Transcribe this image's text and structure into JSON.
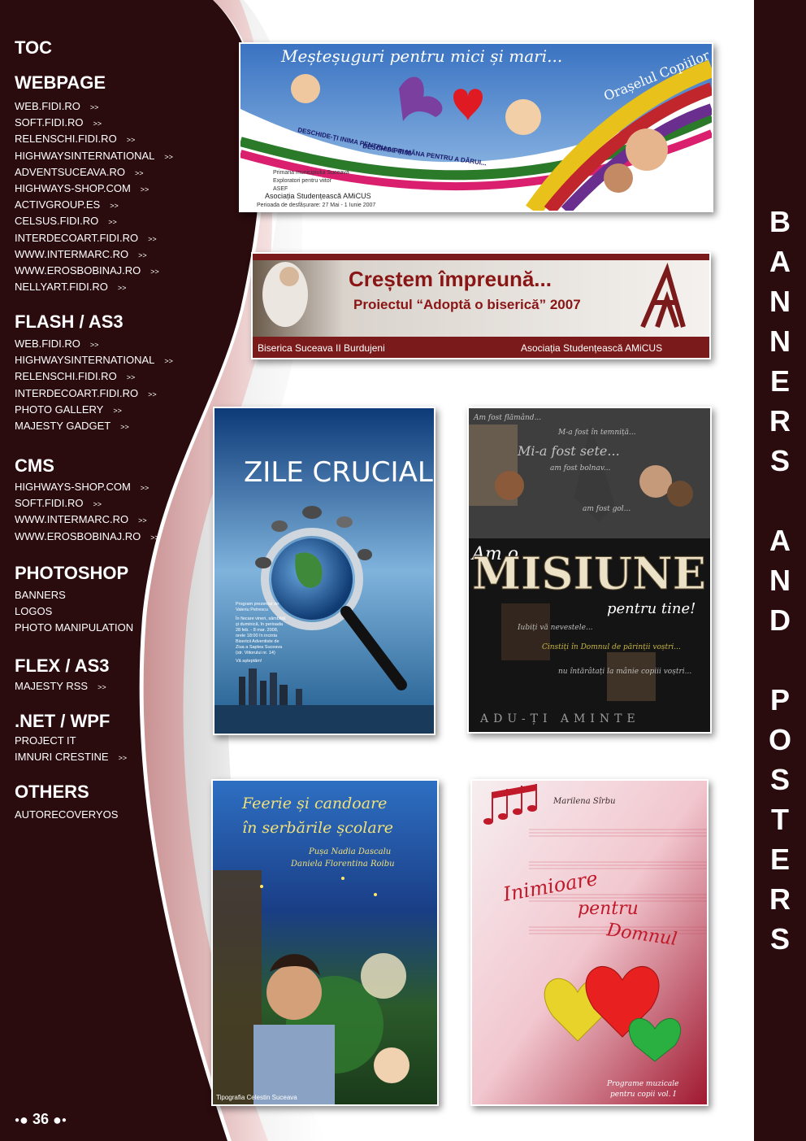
{
  "toc": {
    "title": "TOC",
    "sections": [
      {
        "title": "WEBPAGE",
        "items": [
          {
            "label": "WEB.FIDI.RO",
            "arrow": ">>"
          },
          {
            "label": "SOFT.FIDI.RO",
            "arrow": ">>"
          },
          {
            "label": "RELENSCHI.FIDI.RO",
            "arrow": ">>"
          },
          {
            "label": "HIGHWAYSINTERNATIONAL",
            "arrow": ">>"
          },
          {
            "label": "ADVENTSUCEAVA.RO",
            "arrow": ">>"
          },
          {
            "label": "HIGHWAYS-SHOP.COM",
            "arrow": ">>"
          },
          {
            "label": "ACTIVGROUP.ES",
            "arrow": ">>"
          },
          {
            "label": "CELSUS.FIDI.RO",
            "arrow": ">>"
          },
          {
            "label": "INTERDECOART.FIDI.RO",
            "arrow": ">>"
          },
          {
            "label": "WWW.INTERMARC.RO",
            "arrow": ">>"
          },
          {
            "label": "WWW.EROSBOBINAJ.RO",
            "arrow": ">>"
          },
          {
            "label": "NELLYART.FIDI.RO",
            "arrow": ">>"
          }
        ]
      },
      {
        "title": "FLASH / AS3",
        "items": [
          {
            "label": "WEB.FIDI.RO",
            "arrow": ">>"
          },
          {
            "label": "HIGHWAYSINTERNATIONAL",
            "arrow": ">>"
          },
          {
            "label": "RELENSCHI.FIDI.RO",
            "arrow": ">>"
          },
          {
            "label": "INTERDECOART.FIDI.RO",
            "arrow": ">>"
          },
          {
            "label": "PHOTO GALLERY",
            "arrow": ">>"
          },
          {
            "label": "MAJESTY GADGET",
            "arrow": ">>"
          }
        ]
      },
      {
        "title": "CMS",
        "items": [
          {
            "label": "HIGHWAYS-SHOP.COM",
            "arrow": ">>"
          },
          {
            "label": "SOFT.FIDI.RO",
            "arrow": ">>"
          },
          {
            "label": "WWW.INTERMARC.RO",
            "arrow": ">>"
          },
          {
            "label": "WWW.EROSBOBINAJ.RO",
            "arrow": ">>"
          }
        ]
      },
      {
        "title": "PHOTOSHOP",
        "items": [
          {
            "label": "BANNERS",
            "arrow": ""
          },
          {
            "label": "LOGOS",
            "arrow": ""
          },
          {
            "label": "PHOTO MANIPULATION",
            "arrow": ""
          }
        ]
      },
      {
        "title": "FLEX / AS3",
        "items": [
          {
            "label": "MAJESTY RSS",
            "arrow": ">>"
          }
        ]
      },
      {
        "title": ".NET / WPF",
        "items": [
          {
            "label": "PROJECT IT",
            "arrow": ""
          },
          {
            "label": "IMNURI CRESTINE",
            "arrow": ">>"
          }
        ]
      },
      {
        "title": "OTHERS",
        "items": [
          {
            "label": "AUTORECOVERYOS",
            "arrow": ""
          }
        ]
      }
    ]
  },
  "page_number": "36",
  "side_title": "BANNERS AND POSTERS",
  "banners": [
    {
      "heading": "Meșteșuguri pentru mici și mari...",
      "arc_text": "Orașelul Copiilor",
      "slogan_1": "DESCHIDE-ȚI INIMA PENTRU A PRIMI",
      "slogan_2": "DESCHIDE-ȚI MÂNA PENTRU A DĂRUI...",
      "credits": [
        "Primaria municipiului Suceava",
        "Exploratori pentru viitor",
        "ASEF",
        "Asociația Studențească AMiCUS",
        "Perioada de desfășurare: 27 Mai - 1 Iunie 2007"
      ]
    },
    {
      "heading": "Creștem împreună...",
      "subheading": "Proiectul “Adoptă o biserică” 2007",
      "footer_left": "Biserica Suceava II Burdujeni",
      "footer_right": "Asociația Studențească AMiCUS"
    }
  ],
  "posters": [
    {
      "title": "ZILE CRUCIALE",
      "body": [
        "Program prezentat de",
        "Valeriu Petrescu",
        "În fiecare vineri, sâmbătă",
        "și duminică, în perioada",
        "28 feb. - 8 mar. 2008,",
        "orele 18:00 în incinta",
        "Bisericii Adventiste de",
        "Ziua a Saptea Suceava",
        "(str. Viitorului nr. 14)",
        "Vă așteptăm!"
      ]
    },
    {
      "title": "MISIUNE",
      "prefix": "Am o",
      "tagline": "pentru tine!",
      "lines": [
        "Am fost flămând...",
        "M-a fost în temniță...",
        "Mi-a fost sete...",
        "am fost bolnav...",
        "am fost gol...",
        "Iubiți vă nevestele...",
        "Cinstiți în Domnul de părinții voștri...",
        "nu întărâtați la mânie copiii voștri..."
      ],
      "footer": "ADU-ȚI AMINTE"
    },
    {
      "title_1": "Feerie și candoare",
      "title_2": "în serbările școlare",
      "author_1": "Pușa Nadia Dascalu",
      "author_2": "Daniela Florentina Roibu",
      "footer": "Tipografia Celestin Suceava"
    },
    {
      "author": "Marilena Sîrbu",
      "title_1": "Inimioare",
      "title_2": "pentru",
      "title_3": "Domnul",
      "footer_1": "Programe muzicale",
      "footer_2": "pentru copii vol. I"
    }
  ],
  "colors": {
    "dark": "#2a0b0e",
    "pink": "#d4a4a4",
    "white": "#ffffff"
  }
}
